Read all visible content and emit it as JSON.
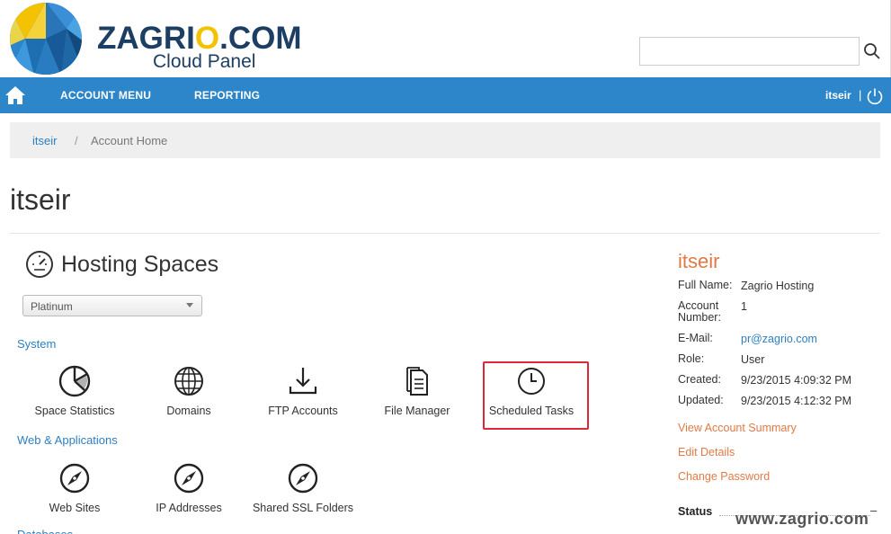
{
  "header": {
    "brand_name": "ZAGRI",
    "brand_o": "O",
    "brand_suffix": ".COM",
    "brand_sub": "Cloud Panel",
    "search_placeholder": ""
  },
  "nav": {
    "items": [
      "ACCOUNT MENU",
      "REPORTING"
    ],
    "user": "itseir",
    "separator": "|"
  },
  "breadcrumb": {
    "link": "itseir",
    "separator": "/",
    "current": "Account Home"
  },
  "page_title": "itseir",
  "hosting": {
    "title": "Hosting Spaces",
    "plan_select": "Platinum",
    "groups": [
      {
        "label": "System",
        "items": [
          "Space Statistics",
          "Domains",
          "FTP Accounts",
          "File Manager",
          "Scheduled Tasks"
        ]
      },
      {
        "label": "Web & Applications",
        "items": [
          "Web Sites",
          "IP Addresses",
          "Shared SSL Folders"
        ]
      }
    ],
    "cut_group_label": "Databases"
  },
  "account": {
    "name": "itseir",
    "fields": [
      {
        "label": "Full Name:",
        "value": "Zagrio Hosting"
      },
      {
        "label": "Account Number:",
        "value": "1"
      },
      {
        "label": "E-Mail:",
        "value": "pr@zagrio.com"
      },
      {
        "label": "Role:",
        "value": "User"
      },
      {
        "label": "Created:",
        "value": "9/23/2015 4:09:32 PM"
      },
      {
        "label": "Updated:",
        "value": "9/23/2015 4:12:32 PM"
      }
    ],
    "actions": [
      "View Account Summary",
      "Edit Details",
      "Change Password"
    ],
    "status_label": "Status",
    "status_toggle": "–"
  },
  "watermark": "www.zagrio.com",
  "colors": {
    "nav_bg": "#2d86c9",
    "link": "#2d7fc1",
    "accent_orange": "#e07a45",
    "highlight_red": "#dc2837",
    "brand_navy": "#1d3e63",
    "brand_yellow": "#f3c200"
  },
  "icons": {
    "search": "magnifier-icon",
    "home": "home-icon",
    "power": "power-icon",
    "hosting": "gauge-icon"
  }
}
